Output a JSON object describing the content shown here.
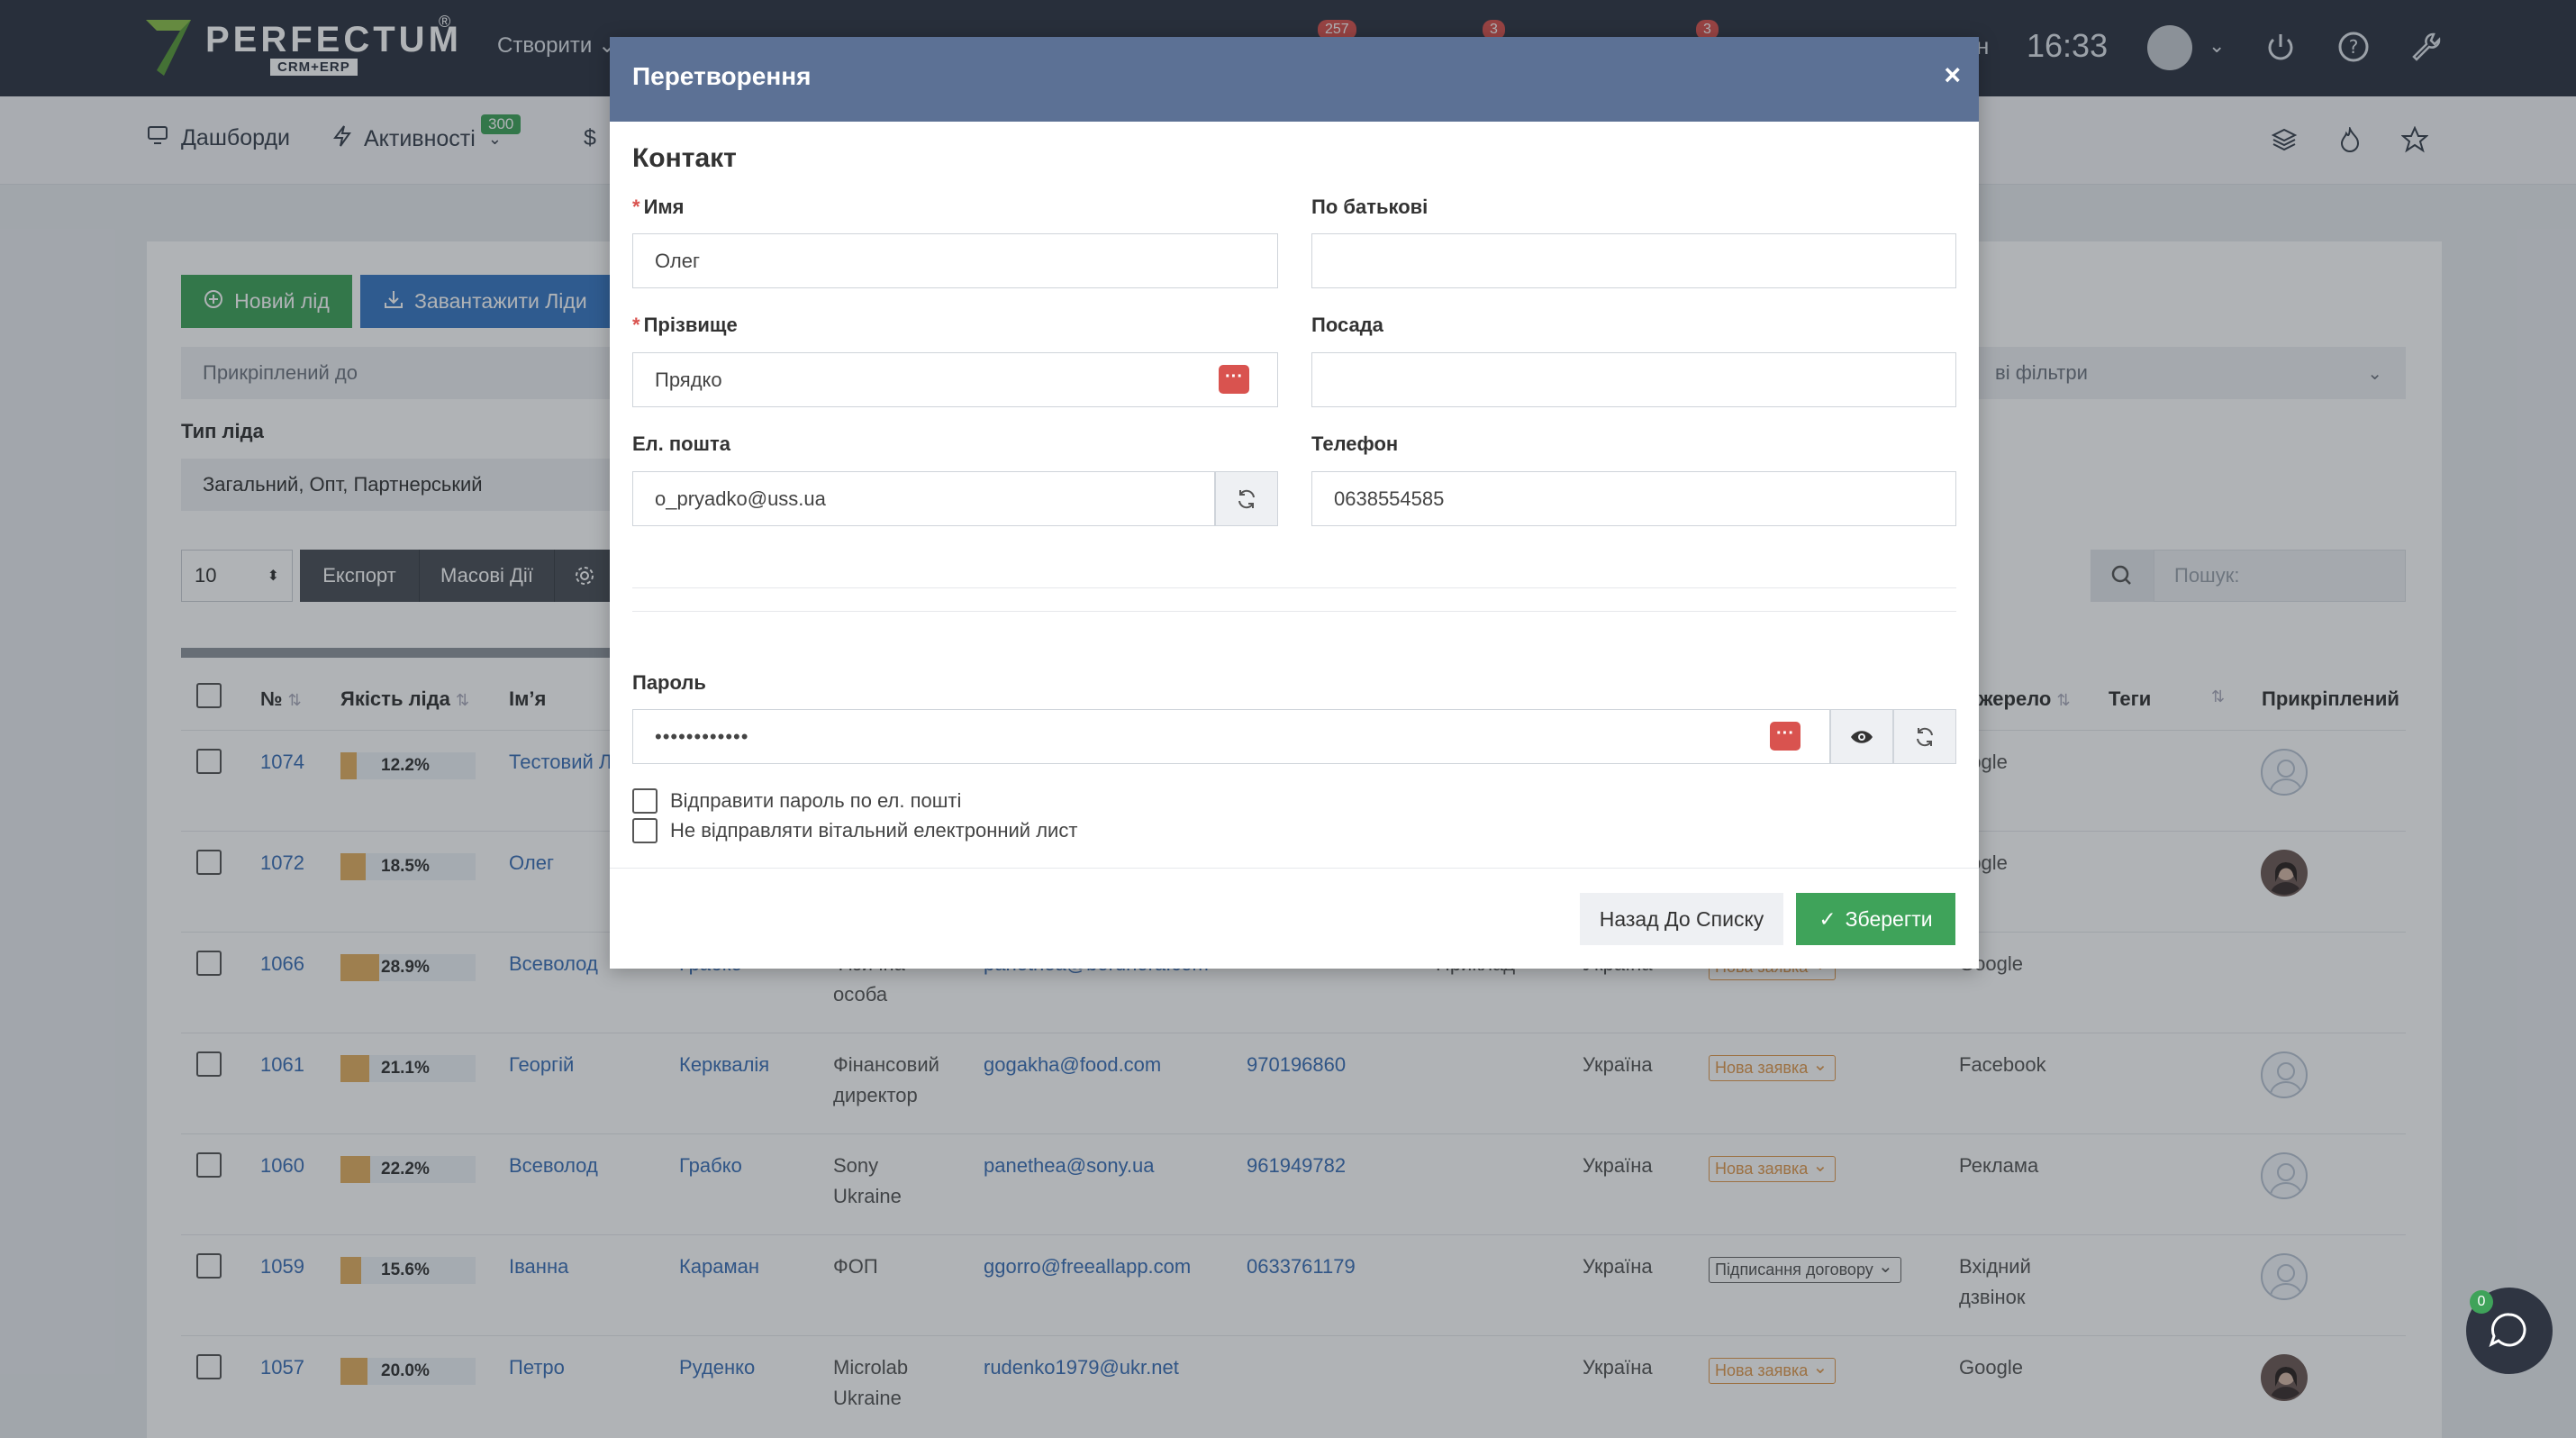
{
  "topbar": {
    "logo_name": "PERFECTUM",
    "logo_sub": "CRM+ERP",
    "logo_reg": "®",
    "create_label": "Створити",
    "badges": [
      "257",
      "3",
      "3"
    ],
    "clock": "16:33",
    "partial_letter": "н"
  },
  "subnav": {
    "dashboards": "Дашборди",
    "activities": "Активності",
    "activities_count": "300",
    "currency": "$"
  },
  "toolbar": {
    "new_lead": "Новий лід",
    "load_leads": "Завантажити Ліди",
    "attached_placeholder": "Прикріплений до",
    "filters_placeholder": "ві фільтри",
    "lead_type_label": "Тип ліда",
    "lead_type_value": "Загальний, Опт, Партнерський",
    "per_page": "10",
    "export": "Експорт",
    "bulk": "Масові Дії",
    "search_placeholder": "Пошук:"
  },
  "table": {
    "headers": {
      "num": "№",
      "quality": "Якість ліда",
      "name": "Ім’я",
      "source": "жерело",
      "tags": "Теги",
      "attached": "Прикріплений"
    },
    "rows": [
      {
        "id": "1074",
        "quality": "12.2%",
        "q": 0.122,
        "name": "Тестовий Л",
        "last": "",
        "company": "",
        "email": "",
        "phone": "",
        "country": "",
        "status": "",
        "source": "oogle",
        "avatar": "blank"
      },
      {
        "id": "1072",
        "quality": "18.5%",
        "q": 0.185,
        "name": "Олег",
        "last": "",
        "company": "",
        "email": "",
        "phone": "",
        "country": "",
        "status": "",
        "source": "oogle",
        "avatar": "photo"
      },
      {
        "id": "1066",
        "quality": "28.9%",
        "q": 0.289,
        "name": "Всеволод",
        "last": "Грабко",
        "company": "Фізична особа",
        "email": "panethea@borunora.com",
        "phone": "",
        "extra": "Приклад",
        "country": "Україна",
        "status": "Нова заявка",
        "source": "Google",
        "avatar": ""
      },
      {
        "id": "1061",
        "quality": "21.1%",
        "q": 0.211,
        "name": "Георгій",
        "last": "Керквалія",
        "company": "Фінансовий директор",
        "email": "gogakha@food.com",
        "phone": "970196860",
        "country": "Україна",
        "status": "Нова заявка",
        "source": "Facebook",
        "avatar": "blank"
      },
      {
        "id": "1060",
        "quality": "22.2%",
        "q": 0.222,
        "name": "Всеволод",
        "last": "Грабко",
        "company": "Sony Ukraine",
        "email": "panethea@sony.ua",
        "phone": "961949782",
        "country": "Україна",
        "status": "Нова заявка",
        "source": "Реклама",
        "avatar": "blank"
      },
      {
        "id": "1059",
        "quality": "15.6%",
        "q": 0.156,
        "name": "Іванна",
        "last": "Караман",
        "company": "ФОП",
        "email": "ggorro@freeallapp.com",
        "phone": "0633761179",
        "country": "Україна",
        "status": "Підписання договору",
        "source": "Вхідний дзвінок",
        "avatar": "blank"
      },
      {
        "id": "1057",
        "quality": "20.0%",
        "q": 0.2,
        "name": "Петро",
        "last": "Руденко",
        "company": "Microlab Ukraine",
        "email": "rudenko1979@ukr.net",
        "phone": "",
        "country": "Україна",
        "status": "Нова заявка",
        "source": "Google",
        "avatar": "photo"
      }
    ]
  },
  "modal": {
    "title": "Перетворення",
    "close": "×",
    "section": "Контакт",
    "first_name_label": "Имя",
    "first_name_value": "Олег",
    "middle_name_label": "По батькові",
    "middle_name_value": "",
    "last_name_label": "Прізвище",
    "last_name_value": "Прядко",
    "position_label": "Посада",
    "position_value": "",
    "email_label": "Ел. пошта",
    "email_value": "o_pryadko@uss.ua",
    "phone_label": "Телефон",
    "phone_value": "0638554585",
    "password_label": "Пароль",
    "password_value": "••••••••••••",
    "send_password": "Відправити пароль по ел. пошті",
    "no_welcome": "Не відправляти вітальний електронний лист",
    "back": "Назад До Списку",
    "save": "Зберегти"
  },
  "chat": {
    "count": "0"
  },
  "colors": {
    "accent_green": "#3fa35a",
    "accent_blue": "#3a78c3",
    "header": "#5c7195",
    "topbar": "#2f3542"
  }
}
